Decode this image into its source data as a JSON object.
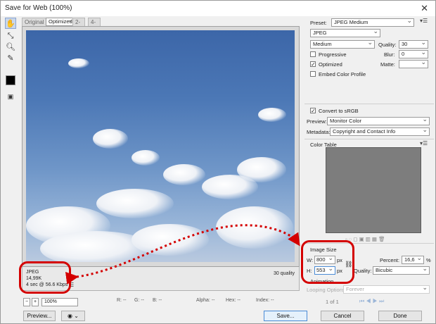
{
  "window": {
    "title": "Save for Web (100%)",
    "close_glyph": "✕"
  },
  "tools": [
    "hand-tool-icon",
    "slice-select-tool-icon",
    "zoom-tool-icon",
    "eyedropper-tool-icon"
  ],
  "tabs": [
    {
      "label": "Original",
      "selected": false
    },
    {
      "label": "Optimized",
      "selected": true
    },
    {
      "label": "2-Up",
      "selected": false
    },
    {
      "label": "4-Up",
      "selected": false
    }
  ],
  "preview_info": {
    "format": "JPEG",
    "size": "14,99K",
    "download": "4 sec @ 56.6 Kbps",
    "quality": "30 quality"
  },
  "status_bar": {
    "zoom": "100%",
    "r": "R: --",
    "g": "G: --",
    "b": "B: --",
    "alpha": "Alpha: --",
    "hex": "Hex: --",
    "index": "Index: --"
  },
  "settings": {
    "preset_label": "Preset:",
    "preset_value": "JPEG Medium",
    "format_value": "JPEG",
    "compression_value": "Medium",
    "quality_label": "Quality:",
    "quality_value": "30",
    "progressive_label": "Progressive",
    "progressive_checked": false,
    "blur_label": "Blur:",
    "blur_value": "0",
    "optimized_label": "Optimized",
    "optimized_checked": true,
    "matte_label": "Matte:",
    "matte_value": "",
    "embed_label": "Embed Color Profile",
    "embed_checked": false,
    "convert_label": "Convert to sRGB",
    "convert_checked": true,
    "preview_label": "Preview:",
    "preview_value": "Monitor Color",
    "metadata_label": "Metadata:",
    "metadata_value": "Copyright and Contact Info"
  },
  "color_table": {
    "title": "Color Table"
  },
  "image_size": {
    "title": "Image Size",
    "w_label": "W:",
    "w_value": "800",
    "h_label": "H:",
    "h_value": "553",
    "unit": "px",
    "percent_label": "Percent:",
    "percent_value": "16,6",
    "percent_unit": "%",
    "quality_label": "Quality:",
    "quality_value": "Bicubic"
  },
  "animation": {
    "title": "Animation",
    "looping_label": "Looping Options:",
    "looping_value": "Forever",
    "frame_counter": "1 of 1"
  },
  "buttons": {
    "preview": "Preview...",
    "save": "Save...",
    "cancel": "Cancel",
    "done": "Done"
  },
  "colors": {
    "annotation": "#d40000",
    "sky_top": "#3c66a8",
    "sky_bottom": "#b9c9df"
  }
}
